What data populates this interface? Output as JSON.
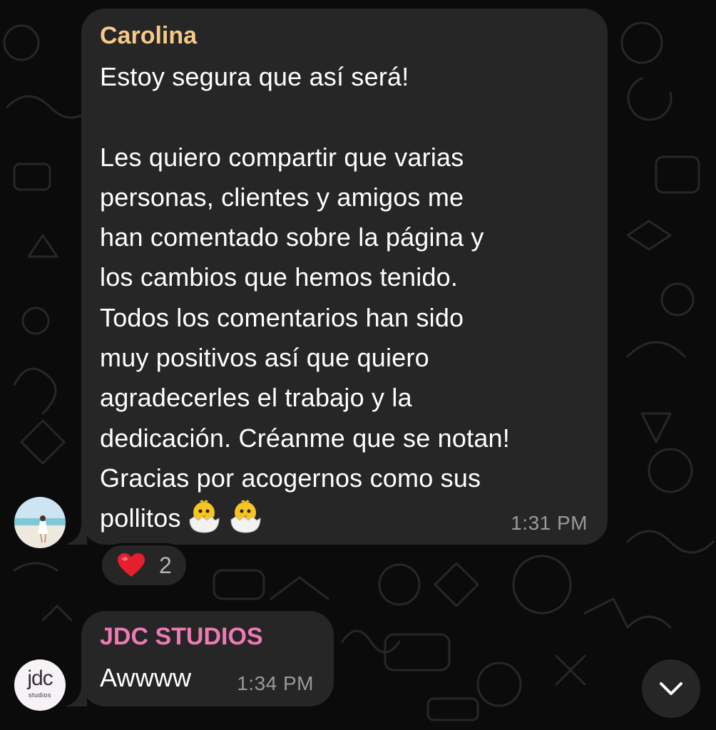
{
  "colors": {
    "background": "#0b0b0b",
    "bubble": "#262626",
    "sender_carolina": "#f6c987",
    "sender_jdc": "#ef7ab3",
    "timestamp": "#9a9a9a",
    "reaction_heart": "#e5202e"
  },
  "messages": [
    {
      "sender": "Carolina",
      "text": "Estoy segura que así será!\n\nLes quiero compartir que varias\npersonas, clientes y amigos me\nhan comentado sobre la página y\nlos cambios que hemos tenido.\nTodos los comentarios han sido\nmuy positivos así que quiero\nagradecerles el trabajo y la\ndedicación. Créanme que se notan!\nGracias por acogernos como sus\npollitos",
      "emoji": [
        "hatching-chick-icon",
        "hatching-chick-icon"
      ],
      "time": "1:31 PM",
      "reaction": {
        "icon": "heart-icon",
        "count": "2"
      }
    },
    {
      "sender": "JDC STUDIOS",
      "text": "Awwww",
      "time": "1:34 PM",
      "avatar_text": "jdc",
      "avatar_subtext": "studios"
    }
  ],
  "scroll_down": {
    "icon": "chevron-down-icon"
  }
}
